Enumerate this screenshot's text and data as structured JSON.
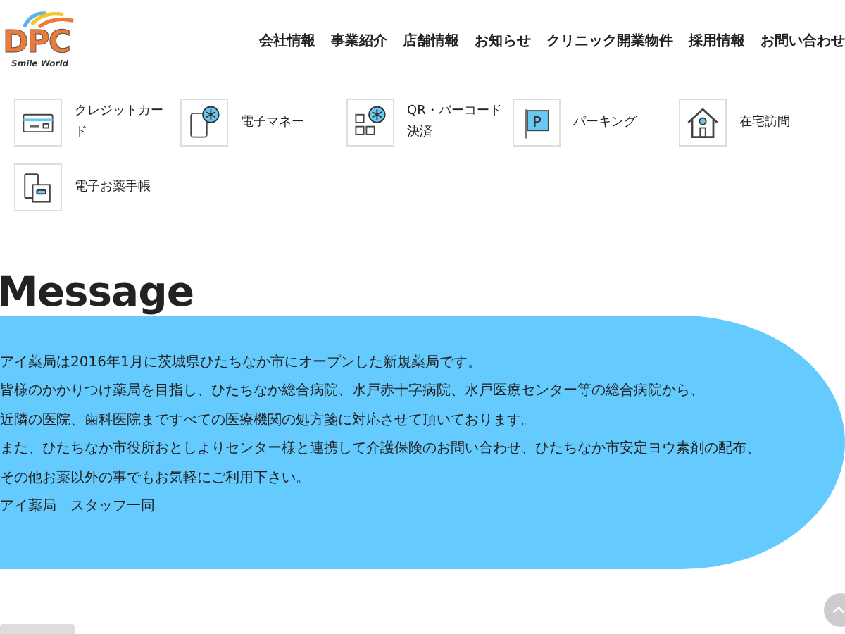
{
  "logo": {
    "letters": "DPC",
    "tagline": "Smile World"
  },
  "nav": [
    "会社情報",
    "事業紹介",
    "店舗情報",
    "お知らせ",
    "クリニック開業物件",
    "採用情報",
    "お問い合わせ"
  ],
  "services": [
    {
      "kind": "card",
      "label": "クレジットカード"
    },
    {
      "kind": "emoney",
      "label": "電子マネー"
    },
    {
      "kind": "qr",
      "label": "QR・バーコード決済"
    },
    {
      "kind": "parking",
      "label": "パーキング",
      "sign": "P"
    },
    {
      "kind": "home",
      "label": "在宅訪問"
    },
    {
      "kind": "notebook",
      "label": "電子お薬手帳"
    }
  ],
  "message": {
    "title": "Message",
    "lines": [
      "アイ薬局は2016年1月に茨城県ひたちなか市にオープンした新規薬局です。",
      "皆様のかかりつけ薬局を目指し、ひたちなか総合病院、水戸赤十字病院、水戸医療センター等の総合病院から、",
      "近隣の医院、歯科医院まですべての医療機関の処方箋に対応させて頂いております。",
      "また、ひたちなか市役所おとしよりセンター様と連携して介護保険のお問い合わせ、ひたちなか市安定ヨウ素剤の配布、",
      "その他お薬以外の事でもお気軽にご利用下さい。",
      "アイ薬局　スタッフ一同"
    ]
  }
}
